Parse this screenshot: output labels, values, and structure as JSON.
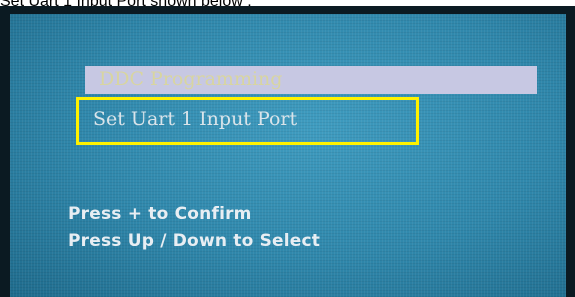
{
  "caption": "Set Uart 1 Input Port shown below :",
  "menu": {
    "items": [
      {
        "label": "DDC Programming",
        "state": "normal"
      },
      {
        "label": "Set Uart 1 Input Port",
        "state": "selected"
      }
    ]
  },
  "hints": {
    "confirm": "Press + to Confirm",
    "select": "Press Up / Down to Select"
  },
  "colors": {
    "screen_background": "#2f87ab",
    "highlight_border": "#fff200",
    "menu_bar": "#c7c8e3"
  }
}
